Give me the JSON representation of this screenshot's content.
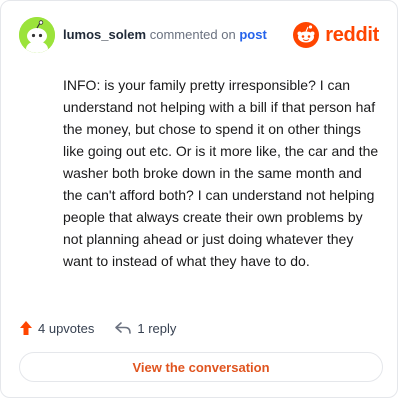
{
  "header": {
    "username": "lumos_solem",
    "action_text": "commented on",
    "post_link": "post",
    "brand_name": "reddit"
  },
  "comment": {
    "text": "INFO: is your family pretty irresponsible? I can understand not helping with a bill if that person haf the money, but chose to spend it on other things like going out etc. Or is it more like, the car and the washer both broke down in the same month and the can't afford both? I can understand not helping people that always create their own problems by not planning ahead or just doing whatever they want to instead of what they have to do."
  },
  "footer": {
    "upvotes": "4 upvotes",
    "replies": "1 reply"
  },
  "cta": {
    "label": "View the conversation"
  },
  "colors": {
    "brand": "#ff4500",
    "avatar_bg": "#9be33b",
    "link": "#2563eb",
    "cta_text": "#e0541f"
  },
  "icons": [
    "snoo-avatar-icon",
    "reddit-logo-icon",
    "upvote-arrow-icon",
    "reply-arrow-icon"
  ]
}
